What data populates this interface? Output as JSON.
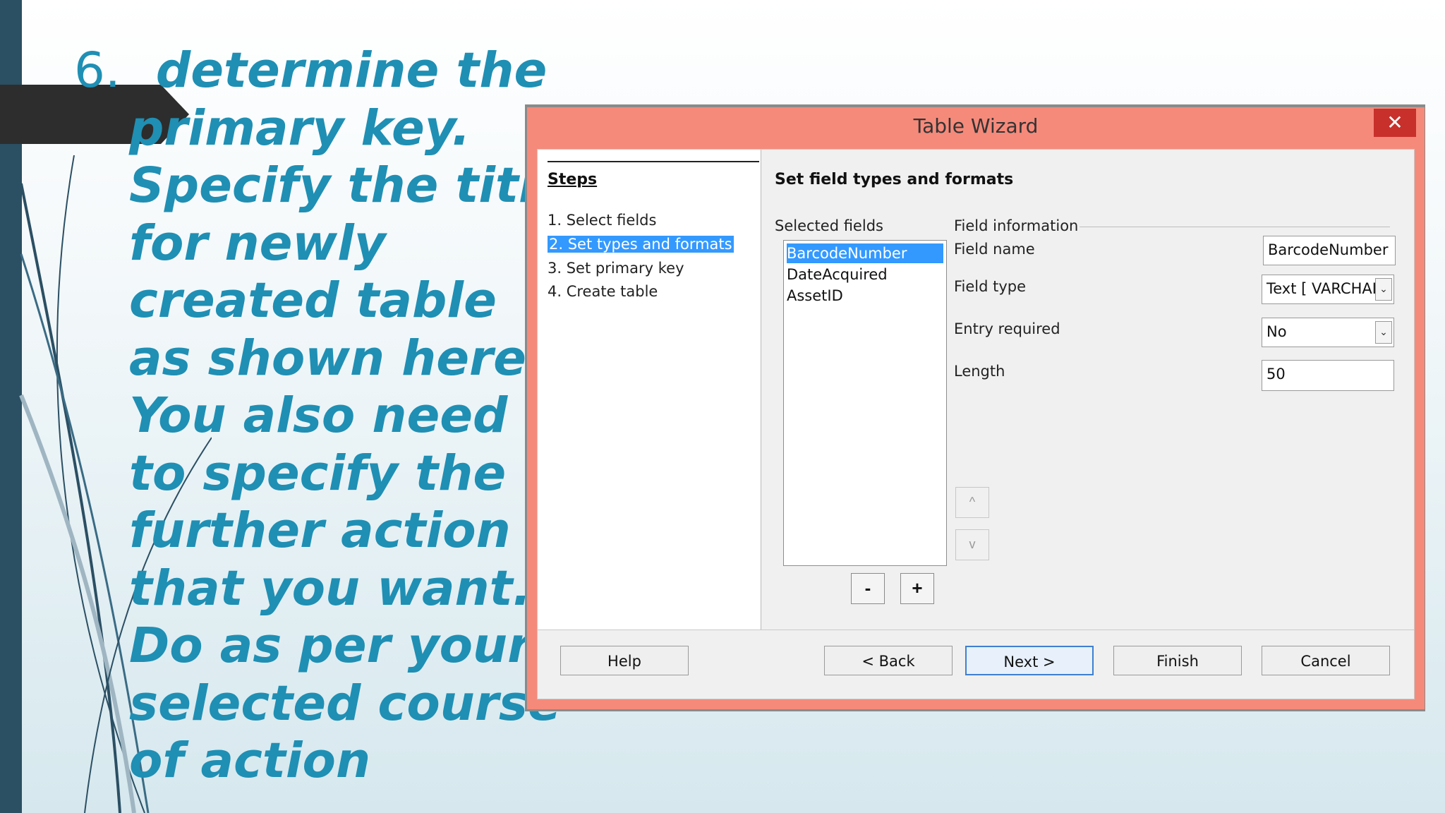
{
  "slide": {
    "number": "6.",
    "lines": [
      "determine the",
      "primary key.",
      "Specify the title",
      "for newly",
      "created table",
      "as shown here.",
      "You also need",
      "to specify the",
      "further action",
      "that you want.",
      "Do as per your",
      "selected course",
      "of action"
    ]
  },
  "dialog": {
    "title": "Table Wizard",
    "close_icon": "close-icon",
    "steps_title": "Steps",
    "steps": [
      "1. Select fields",
      "2. Set types and formats",
      "3. Set primary key",
      "4. Create table"
    ],
    "section_title": "Set field types and formats",
    "selected_fields_label": "Selected fields",
    "selected_fields": [
      "BarcodeNumber",
      "DateAcquired",
      "AssetID"
    ],
    "field_info_label": "Field information",
    "field_name_label": "Field name",
    "field_name_value": "BarcodeNumber",
    "field_type_label": "Field type",
    "field_type_value": "Text [ VARCHAI",
    "entry_required_label": "Entry required",
    "entry_required_value": "No",
    "length_label": "Length",
    "length_value": "50",
    "up_arrow": "^",
    "down_arrow": "v",
    "minus_label": "-",
    "plus_label": "+",
    "buttons": {
      "help": "Help",
      "back": "< Back",
      "next": "Next >",
      "finish": "Finish",
      "cancel": "Cancel"
    }
  },
  "colors": {
    "accent_text": "#1f8fb4",
    "dialog_border": "#f58a7b",
    "selection": "#3399ff",
    "close_button": "#c7302b"
  }
}
